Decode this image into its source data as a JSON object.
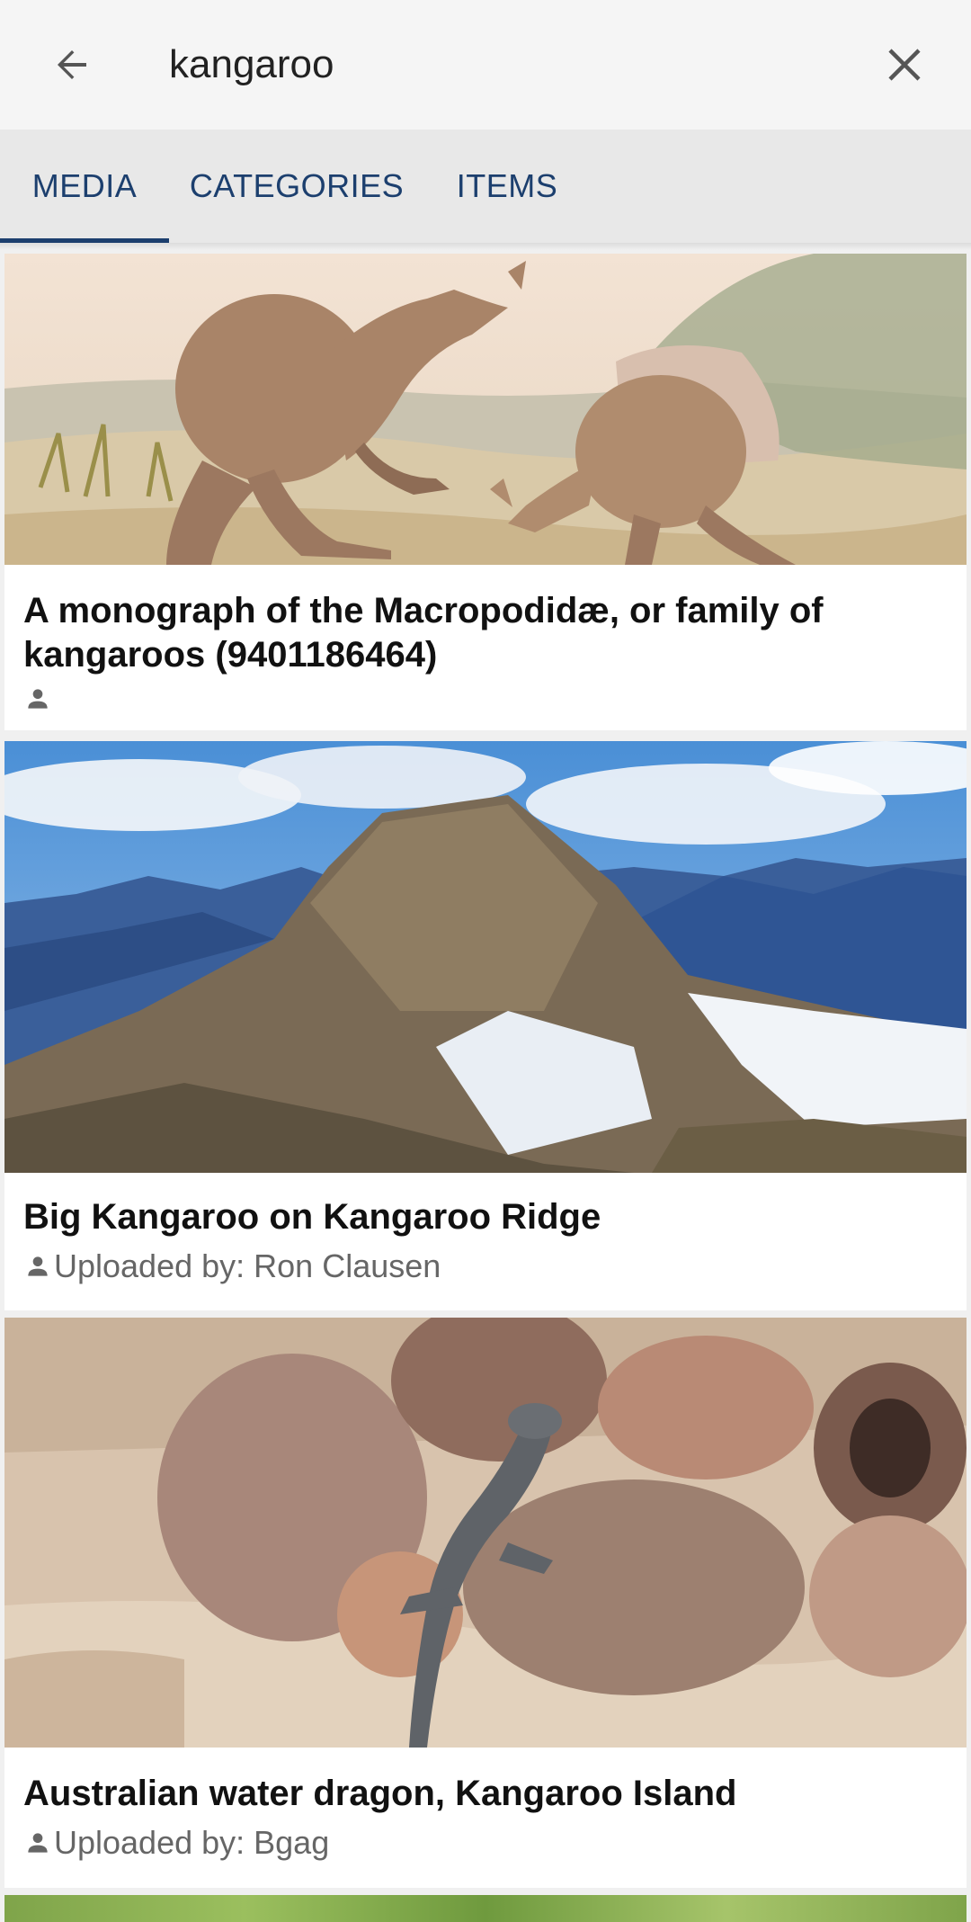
{
  "search": {
    "query": "kangaroo"
  },
  "tabs": [
    {
      "label": "MEDIA",
      "active": true
    },
    {
      "label": "CATEGORIES",
      "active": false
    },
    {
      "label": "ITEMS",
      "active": false
    }
  ],
  "results": [
    {
      "title": "A monograph of the Macropodidæ, or family of kangaroos (9401186464)",
      "uploader_text": ""
    },
    {
      "title": "Big Kangaroo on Kangaroo Ridge",
      "uploader_text": "Uploaded by: Ron Clausen"
    },
    {
      "title": "Australian water dragon, Kangaroo Island",
      "uploader_text": "Uploaded by: Bgag"
    }
  ],
  "colors": {
    "accent": "#1c3f6e",
    "background": "#f0f0f0",
    "card": "#ffffff"
  },
  "icons": {
    "back": "arrow-left-icon",
    "clear": "close-icon",
    "uploader": "person-icon"
  }
}
